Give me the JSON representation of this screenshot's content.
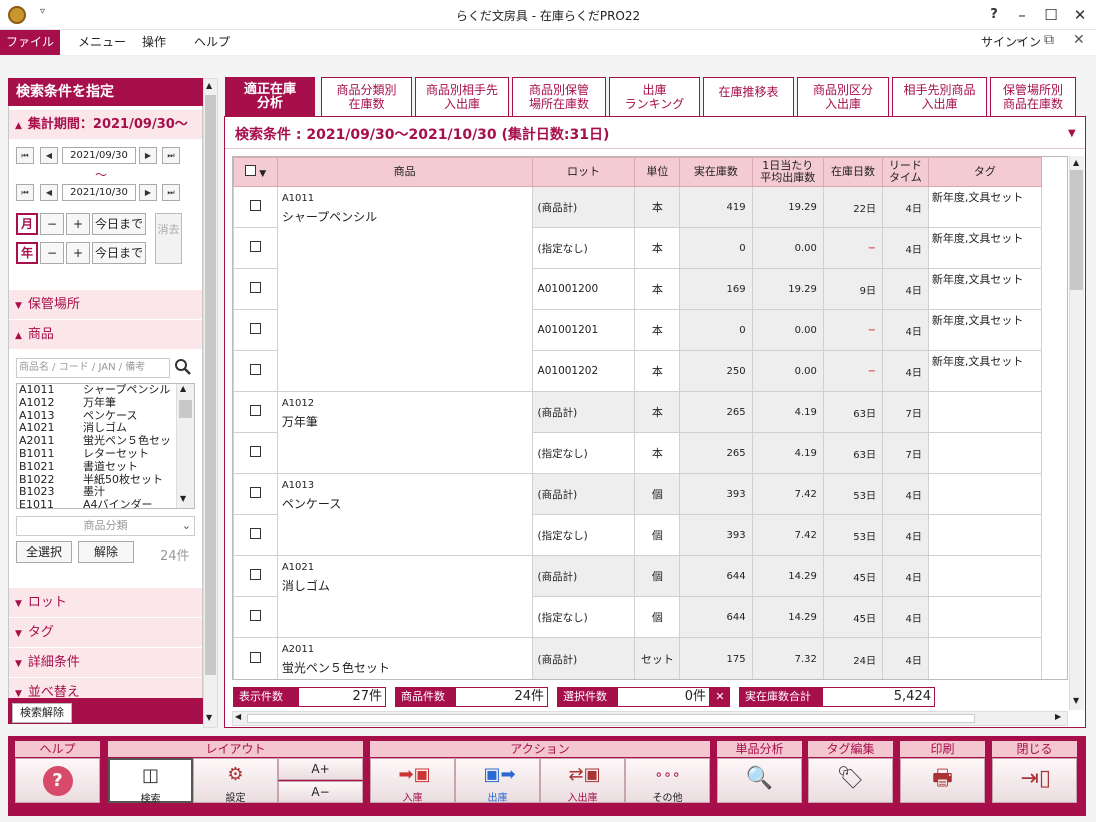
{
  "window": {
    "title": "らくだ文房具 - 在庫らくだPRO22",
    "help_btn": "?",
    "signin": "サインイン"
  },
  "menu": {
    "file": "ファイル",
    "menu": "メニュー",
    "operation": "操作",
    "help": "ヘルプ"
  },
  "left": {
    "title": "検索条件を指定",
    "period_label": "集計期間：2021/09/30〜",
    "date_from": "2021/09/30",
    "tilde": "〜",
    "date_to": "2021/10/30",
    "month": "月",
    "year": "年",
    "minus": "−",
    "plus": "+",
    "today": "今日まで",
    "clear": "消去",
    "storage": "保管場所",
    "product": "商品",
    "search_placeholder": "商品名 / コード / JAN / 備考",
    "products": [
      {
        "code": "A1011",
        "name": "シャープペンシル"
      },
      {
        "code": "A1012",
        "name": "万年筆"
      },
      {
        "code": "A1013",
        "name": "ペンケース"
      },
      {
        "code": "A1021",
        "name": "消しゴム"
      },
      {
        "code": "A2011",
        "name": "蛍光ペン５色セッ"
      },
      {
        "code": "B1011",
        "name": "レターセット"
      },
      {
        "code": "B1021",
        "name": "書道セット"
      },
      {
        "code": "B1022",
        "name": "半紙50枚セット"
      },
      {
        "code": "B1023",
        "name": "墨汁"
      },
      {
        "code": "E1011",
        "name": "A4バインダー"
      }
    ],
    "category": "商品分類",
    "select_all": "全選択",
    "deselect": "解除",
    "count": "24件",
    "lot": "ロット",
    "tag": "タグ",
    "detail": "詳細条件",
    "sort": "並べ替え",
    "search_clear": "検索解除"
  },
  "tabs": [
    "適正在庫\n分析",
    "商品分類別\n在庫数",
    "商品別相手先\n入出庫",
    "商品別保管\n場所在庫数",
    "出庫\nランキング",
    "在庫推移表",
    "商品別区分\n入出庫",
    "相手先別商品\n入出庫",
    "保管場所別\n商品在庫数"
  ],
  "condition": "検索条件 : 2021/09/30〜2021/10/30 (集計日数:31日)",
  "table": {
    "headers": {
      "product": "商品",
      "lot": "ロット",
      "unit": "単位",
      "stock": "実在庫数",
      "avg": "1日当たり\n平均出庫数",
      "days": "在庫日数",
      "lead": "リード\nタイム",
      "tag": "タグ"
    },
    "groups": [
      {
        "code": "A1011",
        "name": "シャープペンシル",
        "rows": [
          {
            "lot": "(商品計)",
            "unit": "本",
            "stock": "419",
            "avg": "19.29",
            "days": "22日",
            "lead": "4日",
            "tag": "新年度,文具セット"
          },
          {
            "lot": "(指定なし)",
            "unit": "本",
            "stock": "0",
            "avg": "0.00",
            "days": "−",
            "lead": "4日",
            "tag": "新年度,文具セット"
          },
          {
            "lot": "A01001200",
            "unit": "本",
            "stock": "169",
            "avg": "19.29",
            "days": "9日",
            "lead": "4日",
            "tag": "新年度,文具セット"
          },
          {
            "lot": "A01001201",
            "unit": "本",
            "stock": "0",
            "avg": "0.00",
            "days": "−",
            "lead": "4日",
            "tag": "新年度,文具セット"
          },
          {
            "lot": "A01001202",
            "unit": "本",
            "stock": "250",
            "avg": "0.00",
            "days": "−",
            "lead": "4日",
            "tag": "新年度,文具セット"
          }
        ]
      },
      {
        "code": "A1012",
        "name": "万年筆",
        "rows": [
          {
            "lot": "(商品計)",
            "unit": "本",
            "stock": "265",
            "avg": "4.19",
            "days": "63日",
            "lead": "7日",
            "tag": ""
          },
          {
            "lot": "(指定なし)",
            "unit": "本",
            "stock": "265",
            "avg": "4.19",
            "days": "63日",
            "lead": "7日",
            "tag": ""
          }
        ]
      },
      {
        "code": "A1013",
        "name": "ペンケース",
        "rows": [
          {
            "lot": "(商品計)",
            "unit": "個",
            "stock": "393",
            "avg": "7.42",
            "days": "53日",
            "lead": "4日",
            "tag": ""
          },
          {
            "lot": "(指定なし)",
            "unit": "個",
            "stock": "393",
            "avg": "7.42",
            "days": "53日",
            "lead": "4日",
            "tag": ""
          }
        ]
      },
      {
        "code": "A1021",
        "name": "消しゴム",
        "rows": [
          {
            "lot": "(商品計)",
            "unit": "個",
            "stock": "644",
            "avg": "14.29",
            "days": "45日",
            "lead": "4日",
            "tag": ""
          },
          {
            "lot": "(指定なし)",
            "unit": "個",
            "stock": "644",
            "avg": "14.29",
            "days": "45日",
            "lead": "4日",
            "tag": ""
          }
        ]
      },
      {
        "code": "A2011",
        "name": "蛍光ペン５色セット",
        "rows": [
          {
            "lot": "(商品計)",
            "unit": "セット",
            "stock": "175",
            "avg": "7.32",
            "days": "24日",
            "lead": "4日",
            "tag": ""
          }
        ]
      }
    ]
  },
  "status": {
    "display_label": "表示件数",
    "display_value": "27件",
    "product_label": "商品件数",
    "product_value": "24件",
    "selected_label": "選択件数",
    "selected_value": "0件",
    "total_label": "実在庫数合計",
    "total_value": "5,424"
  },
  "toolbar": {
    "help": "ヘルプ",
    "layout": "レイアウト",
    "action": "アクション",
    "single": "単品分析",
    "tag_edit": "タグ編集",
    "print": "印刷",
    "close": "閉じる",
    "search": "検索",
    "settings": "設定",
    "font_up": "A+",
    "font_down": "A−",
    "in": "入庫",
    "out": "出庫",
    "inout": "入出庫",
    "other": "その他"
  }
}
